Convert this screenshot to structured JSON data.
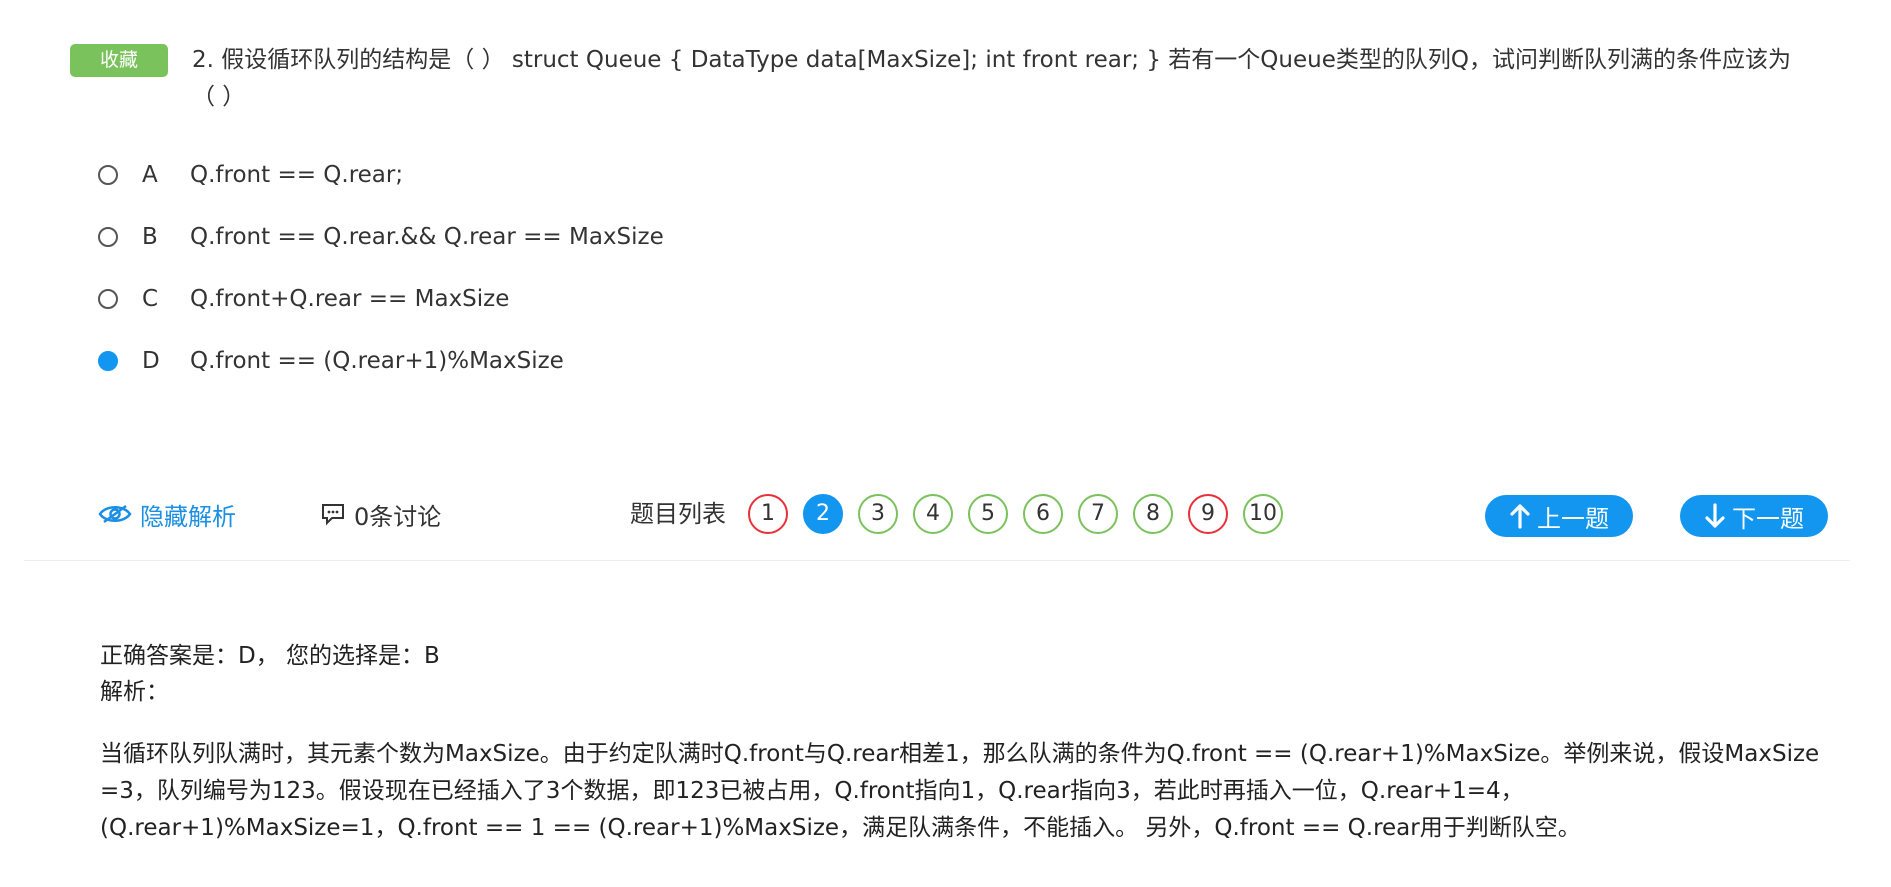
{
  "question": {
    "favorite_label": "收藏",
    "text": "2. 假设循环队列的结构是（ ） struct Queue { DataType data[MaxSize]; int front rear; } 若有一个Queue类型的队列Q，试问判断队列满的条件应该为（ ）"
  },
  "options": [
    {
      "letter": "A",
      "text": "Q.front == Q.rear;",
      "selected": false
    },
    {
      "letter": "B",
      "text": "Q.front == Q.rear.&& Q.rear == MaxSize",
      "selected": false
    },
    {
      "letter": "C",
      "text": "Q.front+Q.rear == MaxSize",
      "selected": false
    },
    {
      "letter": "D",
      "text": "Q.front == (Q.rear+1)%MaxSize",
      "selected": true
    }
  ],
  "toolbar": {
    "hide_analysis_label": "隐藏解析",
    "discussion_label": "0条讨论",
    "question_list_label": "题目列表",
    "question_numbers": [
      {
        "num": "1",
        "status": "wrong"
      },
      {
        "num": "2",
        "status": "current"
      },
      {
        "num": "3",
        "status": "correct"
      },
      {
        "num": "4",
        "status": "correct"
      },
      {
        "num": "5",
        "status": "correct"
      },
      {
        "num": "6",
        "status": "correct"
      },
      {
        "num": "7",
        "status": "correct"
      },
      {
        "num": "8",
        "status": "correct"
      },
      {
        "num": "9",
        "status": "wrong"
      },
      {
        "num": "10",
        "status": "correct"
      }
    ],
    "prev_label": "上一题",
    "next_label": "下一题"
  },
  "analysis": {
    "answer_line": "正确答案是：D， 您的选择是：B",
    "label": "解析：",
    "text": "当循环队列队满时，其元素个数为MaxSize。由于约定队满时Q.front与Q.rear相差1，那么队满的条件为Q.front == (Q.rear+1)%MaxSize。举例来说，假设MaxSize =3，队列编号为123。假设现在已经插入了3个数据，即123已被占用，Q.front指向1，Q.rear指向3，若此时再插入一位，Q.rear+1=4，(Q.rear+1)%MaxSize=1，Q.front == 1 == (Q.rear+1)%MaxSize，满足队满条件，不能插入。 另外，Q.front == Q.rear用于判断队空。"
  },
  "colors": {
    "accent": "#1296f0",
    "favorite_green": "#7ac25b",
    "wrong_red": "#e8303a"
  }
}
